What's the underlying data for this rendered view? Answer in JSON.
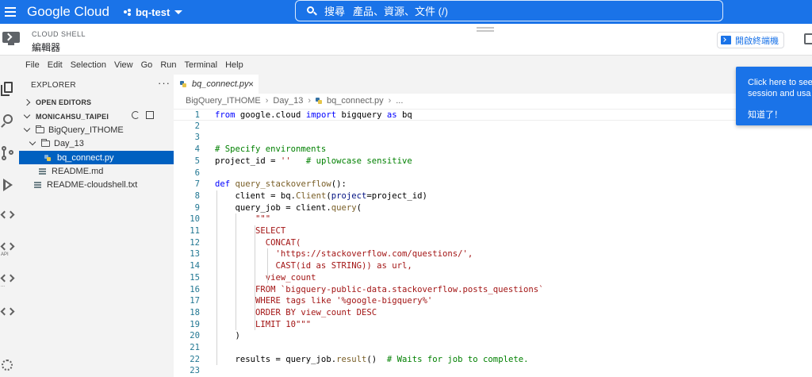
{
  "header": {
    "logo": "Google Cloud",
    "project": "bq-test",
    "search_label": "搜尋",
    "search_placeholder": "產品、資源、文件 (/)"
  },
  "cloud_shell": {
    "title": "CLOUD SHELL",
    "subtitle": "編輯器",
    "open_terminal": "開啟終端機"
  },
  "menu": [
    "File",
    "Edit",
    "Selection",
    "View",
    "Go",
    "Run",
    "Terminal",
    "Help"
  ],
  "activity_bar": {
    "labels": [
      "API",
      "...",
      ""
    ]
  },
  "explorer": {
    "title": "EXPLORER",
    "open_editors": "OPEN EDITORS",
    "workspace": "MONICAHSU_TAIPEI",
    "tree": [
      {
        "label": "BigQuery_ITHOME",
        "type": "folder"
      },
      {
        "label": "Day_13",
        "type": "folder"
      },
      {
        "label": "bq_connect.py",
        "type": "python",
        "selected": true
      },
      {
        "label": "README.md",
        "type": "markdown"
      },
      {
        "label": "README-cloudshell.txt",
        "type": "text"
      }
    ]
  },
  "editor": {
    "tab": "bq_connect.py",
    "breadcrumb": [
      "BigQuery_ITHOME",
      "Day_13",
      "bq_connect.py",
      "..."
    ],
    "line_numbers": [
      "1",
      "2",
      "3",
      "4",
      "5",
      "6",
      "7",
      "8",
      "9",
      "10",
      "11",
      "12",
      "13",
      "14",
      "15",
      "16",
      "17",
      "18",
      "19",
      "20",
      "21",
      "22",
      "23"
    ],
    "code": [
      "from google.cloud import bigquery as bq",
      "",
      "",
      "# Specify environments",
      "project_id = ''   # uplowcase sensitive",
      "",
      "def query_stackoverflow():",
      "    client = bq.Client(project=project_id)",
      "    query_job = client.query(",
      "        \"\"\"",
      "        SELECT",
      "          CONCAT(",
      "            'https://stackoverflow.com/questions/',",
      "            CAST(id as STRING)) as url,",
      "          view_count",
      "        FROM `bigquery-public-data.stackoverflow.posts_questions`",
      "        WHERE tags like '%google-bigquery%'",
      "        ORDER BY view_count DESC",
      "        LIMIT 10\"\"\"",
      "    )",
      "",
      "    results = query_job.result()  # Waits for job to complete.",
      ""
    ]
  },
  "notification": {
    "message": "Click here to see\nsession and usa",
    "button": "知道了！"
  },
  "colors": {
    "header_blue": "#1a73e8",
    "selection_blue": "#0060c0",
    "keyword": "#0000ff",
    "string": "#a31515",
    "comment": "#008000"
  }
}
